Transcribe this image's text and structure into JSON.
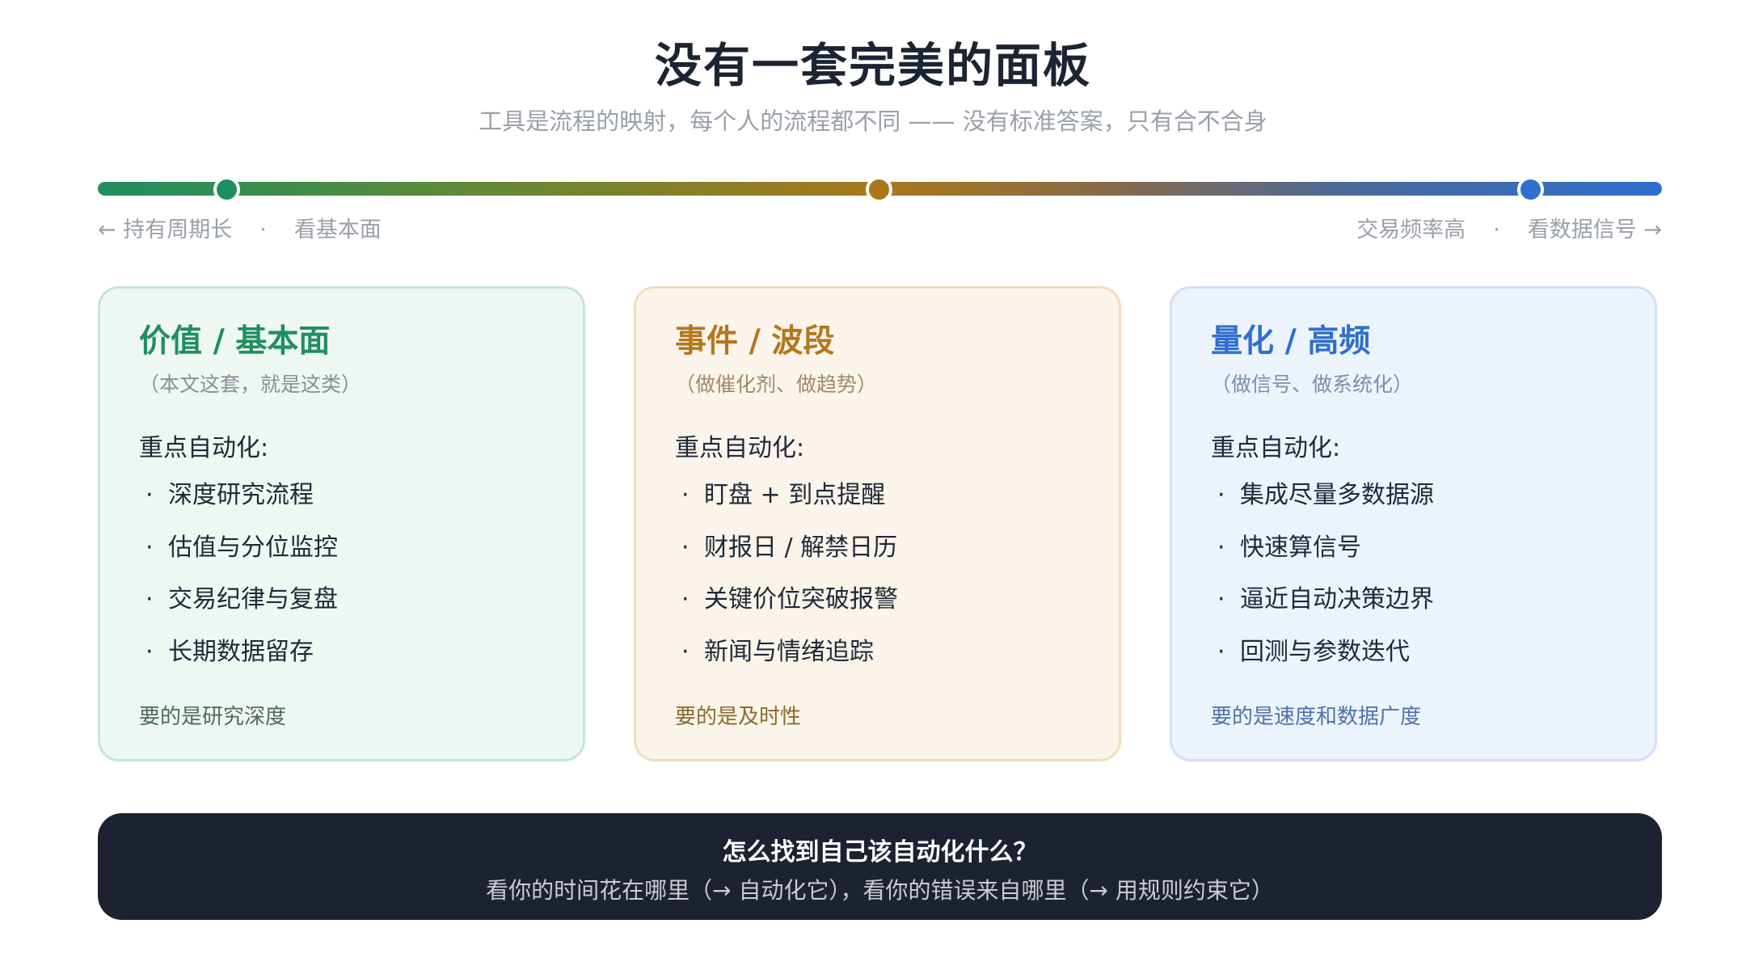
{
  "header": {
    "title": "没有一套完美的面板",
    "subtitle": "工具是流程的映射，每个人的流程都不同 —— 没有标准答案，只有合不合身"
  },
  "scale": {
    "left_a": "← 持有周期长",
    "left_b": "看基本面",
    "right_a": "交易频率高",
    "right_b": "看数据信号 →",
    "separator": "·",
    "dot_colors": [
      "#1f8f5f",
      "#a9781b",
      "#2f6fd0"
    ]
  },
  "cards": [
    {
      "title": "价值 / 基本面",
      "subtitle": "（本文这套，就是这类）",
      "heading": "重点自动化:",
      "items": [
        "深度研究流程",
        "估值与分位监控",
        "交易纪律与复盘",
        "长期数据留存"
      ],
      "footer": "要的是研究深度",
      "accent": "#1f8f5f"
    },
    {
      "title": "事件 / 波段",
      "subtitle": "（做催化剂、做趋势）",
      "heading": "重点自动化:",
      "items": [
        "盯盘 + 到点提醒",
        "财报日 / 解禁日历",
        "关键价位突破报警",
        "新闻与情绪追踪"
      ],
      "footer": "要的是及时性",
      "accent": "#b5761c"
    },
    {
      "title": "量化 / 高频",
      "subtitle": "（做信号、做系统化）",
      "heading": "重点自动化:",
      "items": [
        "集成尽量多数据源",
        "快速算信号",
        "逼近自动决策边界",
        "回测与参数迭代"
      ],
      "footer": "要的是速度和数据广度",
      "accent": "#2f6fd0"
    }
  ],
  "bullet": "·",
  "banner": {
    "title": "怎么找到自己该自动化什么？",
    "text": "看你的时间花在哪里（→ 自动化它），看你的错误来自哪里（→ 用规则约束它）"
  }
}
